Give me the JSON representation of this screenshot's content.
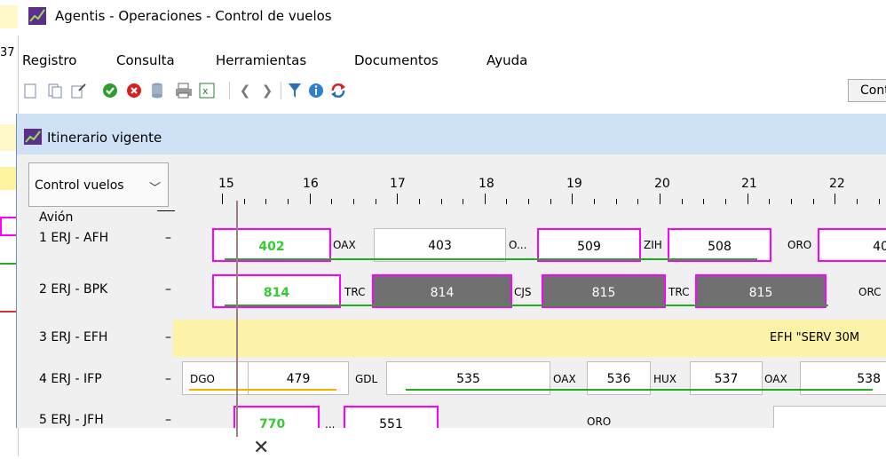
{
  "window": {
    "title": "Agentis - Operaciones - Control de vuelos"
  },
  "left_strip": {
    "fragment_text": "37"
  },
  "menu": [
    "Registro",
    "Consulta",
    "Herramientas",
    "Documentos",
    "Ayuda"
  ],
  "toolbar": {
    "icons": [
      "new-doc-icon",
      "copy-doc-icon",
      "edit-doc-icon",
      "accept-icon",
      "cancel-icon",
      "database-icon",
      "print-icon",
      "export-excel-icon",
      "prev-icon",
      "next-icon",
      "filter-icon",
      "info-icon",
      "refresh-icon"
    ],
    "cont_button": "Cont"
  },
  "inner": {
    "title": "Itinerario vigente",
    "dropdown": "Control vuelos",
    "avion_header": "Avión",
    "hours": [
      "15",
      "16",
      "17",
      "18",
      "19",
      "20",
      "21",
      "22"
    ],
    "rows": [
      {
        "label": "1 ERJ - AFH",
        "dash": "–"
      },
      {
        "label": "2 ERJ - BPK",
        "dash": "–"
      },
      {
        "label": "3 ERJ - EFH",
        "dash": "–"
      },
      {
        "label": "4 ERJ - IFP",
        "dash": "–"
      },
      {
        "label": "5 ERJ - JFH",
        "dash": "–"
      }
    ],
    "row1": {
      "f1": "402",
      "c1": "OAX",
      "f2": "403",
      "c2": "O...",
      "f3": "509",
      "c3": "ZIH",
      "f4": "508",
      "c4": "ORO",
      "f5": "40"
    },
    "row2": {
      "f1": "814",
      "c1": "TRC",
      "f2": "814",
      "c2": "CJS",
      "f3": "815",
      "c3": "TRC",
      "f4": "815",
      "c4": "ORC"
    },
    "row3": {
      "text": "EFH \"SERV 30M"
    },
    "row4": {
      "c0": "DGO",
      "f1": "479",
      "c1": "GDL",
      "f2": "535",
      "c2": "OAX",
      "f3": "536",
      "c3": "HUX",
      "f4": "537",
      "c4": "OAX",
      "f5": "538"
    },
    "row5": {
      "f1": "770",
      "c1": "...",
      "f2": "551",
      "c2": "ORO"
    }
  },
  "colors": {
    "selection": "#ff00ff",
    "on_time": "#22aa22",
    "delay": "#f0b400",
    "grey_flight": "#707070",
    "window_title": "#cfe2f5"
  }
}
